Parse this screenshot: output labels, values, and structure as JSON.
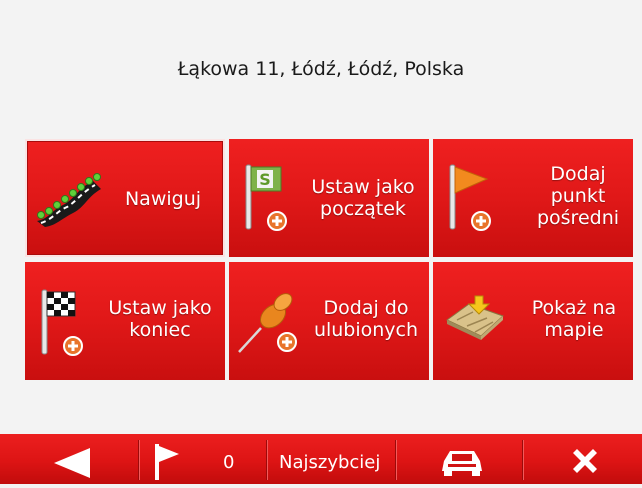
{
  "address": "Łąkowa 11, Łódź, Łódź, Polska",
  "tiles": [
    {
      "label": "Nawiguj",
      "icon": "road-navigate-icon"
    },
    {
      "label": "Ustaw jako początek",
      "icon": "start-flag-icon"
    },
    {
      "label": "Dodaj punkt pośredni",
      "icon": "waypoint-flag-icon"
    },
    {
      "label": "Ustaw jako koniec",
      "icon": "finish-flag-icon"
    },
    {
      "label": "Dodaj do ulubionych",
      "icon": "pushpin-icon"
    },
    {
      "label": "Pokaż na mapie",
      "icon": "map-icon"
    }
  ],
  "bottom_bar": {
    "waypoints_count": "0",
    "route_mode": "Najszybciej",
    "icons": [
      "back-arrow-icon",
      "flag-icon",
      "car-icon",
      "close-icon"
    ]
  },
  "colors": {
    "tile_red": "#e01818",
    "background": "#f3f3f3",
    "bar_red": "#dd1414"
  }
}
